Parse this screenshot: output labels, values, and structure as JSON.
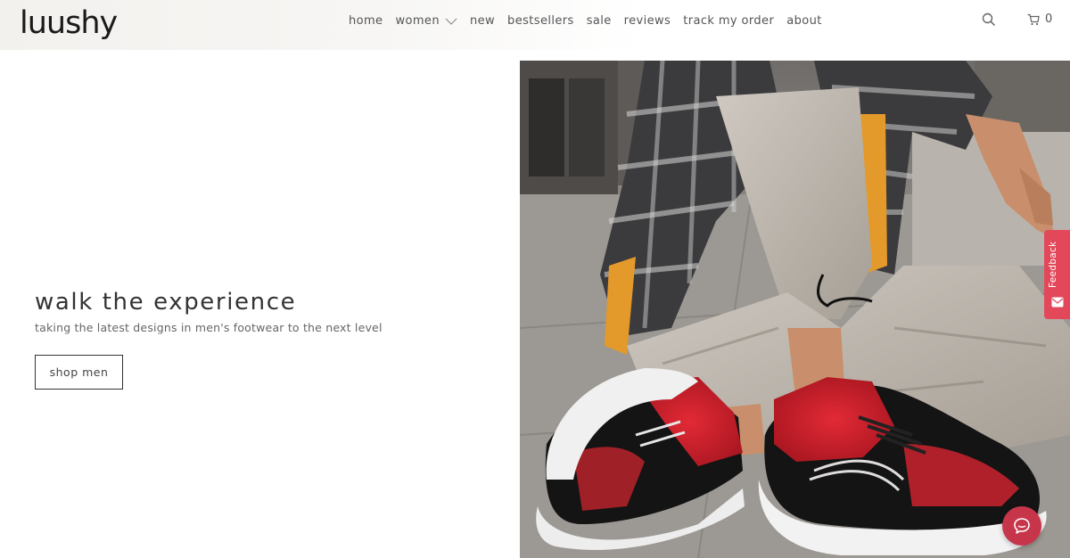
{
  "brand": {
    "logo_text": "luushy"
  },
  "nav": {
    "items": [
      {
        "label": "home"
      },
      {
        "label": "women",
        "has_dropdown": true
      },
      {
        "label": "new"
      },
      {
        "label": "bestsellers"
      },
      {
        "label": "sale"
      },
      {
        "label": "reviews"
      },
      {
        "label": "track my order"
      },
      {
        "label": "about"
      }
    ]
  },
  "header_actions": {
    "search_icon": "search-icon",
    "cart_icon": "cart-icon",
    "cart_count": "0"
  },
  "hero": {
    "title": "walk the experience",
    "subtitle": "taking the latest designs in men's footwear to the next level",
    "cta_label": "shop men",
    "image_subject": "person sitting on pavement wearing black and red knit sneakers with white chunky soles, beige cargo pants, plaid shirt"
  },
  "feedback_tab": {
    "label": "Feedback",
    "icon": "mail-icon"
  },
  "chat_widget": {
    "icon": "chat-icon"
  },
  "colors": {
    "accent_red": "#e3485a",
    "chat_red": "#c7354b",
    "text_dark": "#333333",
    "shoe_red": "#d8202e"
  }
}
